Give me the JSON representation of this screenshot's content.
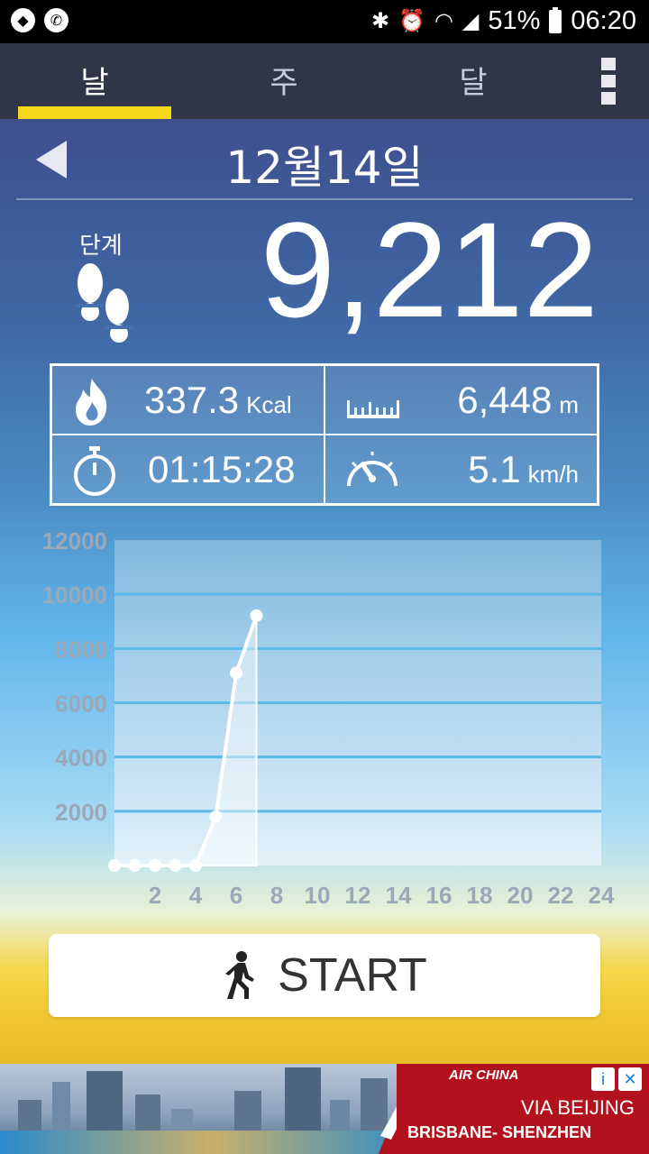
{
  "status_bar": {
    "battery": "51%",
    "time": "06:20",
    "icons": [
      "app-icon",
      "phone-icon",
      "bluetooth-icon",
      "alarm-icon",
      "wifi-icon",
      "signal-icon",
      "battery-icon"
    ]
  },
  "tabs": [
    {
      "label": "날",
      "active": true
    },
    {
      "label": "주",
      "active": false
    },
    {
      "label": "달",
      "active": false
    }
  ],
  "header": {
    "date": "12월14일"
  },
  "steps": {
    "label": "단계",
    "value": "9,212"
  },
  "stats": {
    "calories": {
      "value": "337.3",
      "unit": "Kcal"
    },
    "distance": {
      "value": "6,448",
      "unit": "m"
    },
    "duration": {
      "value": "01:15:28",
      "unit": ""
    },
    "speed": {
      "value": "5.1",
      "unit": "km/h"
    }
  },
  "chart_data": {
    "type": "line",
    "x": [
      0,
      1,
      2,
      3,
      4,
      5,
      6,
      7
    ],
    "y": [
      0,
      0,
      0,
      0,
      0,
      1800,
      7100,
      9212
    ],
    "xticks": [
      2,
      4,
      6,
      8,
      10,
      12,
      14,
      16,
      18,
      20,
      22,
      24
    ],
    "yticks": [
      2000,
      4000,
      6000,
      8000,
      10000,
      12000
    ],
    "xlim": [
      0,
      24
    ],
    "ylim": [
      0,
      12000
    ],
    "grid": true,
    "colors": {
      "line": "#ffffff",
      "grid": "#5ab8e6",
      "ticks": "#9aa8b7"
    }
  },
  "start_button": {
    "label": "START"
  },
  "ad": {
    "brand": "AIR CHINA",
    "line1": "VIA BEIJING",
    "line2": "BRISBANE- SHENZHEN",
    "info": "i",
    "close": "✕"
  }
}
